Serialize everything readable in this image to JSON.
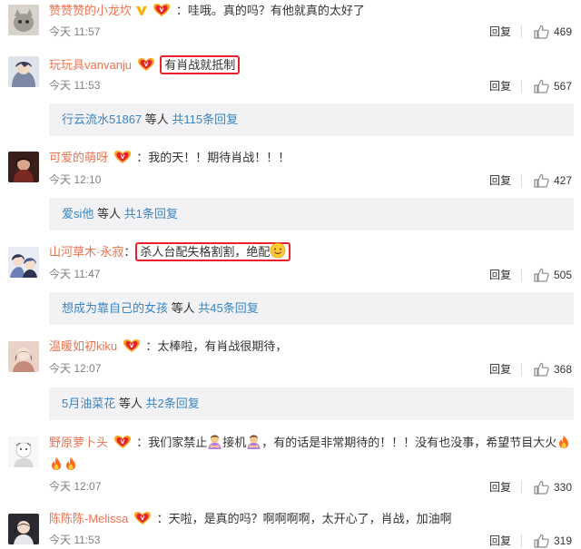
{
  "comments": [
    {
      "username": "赞赞赞的小龙坎",
      "text": "：哇哦。真的吗？有他就真的太好了",
      "time": "今天 11:57",
      "reply": "回复",
      "likes": "469"
    },
    {
      "username": "玩玩具vanvanju",
      "text": "有肖战就抵制",
      "time": "今天 11:53",
      "reply": "回复",
      "likes": "567"
    },
    {
      "username": "可爱的萌呀",
      "text": "：我的天！！期待肖战！！！",
      "time": "今天 12:10",
      "reply": "回复",
      "likes": "427"
    },
    {
      "username": "山河草木·永寂",
      "text": "杀人台配失格割割，绝配",
      "time": "今天 11:47",
      "reply": "回复",
      "likes": "505"
    },
    {
      "username": "温暖如初kiku",
      "text": "：太棒啦，有肖战很期待，",
      "time": "今天 12:07",
      "reply": "回复",
      "likes": "368"
    },
    {
      "username": "野原萝卜头",
      "text_a": "：我们家禁止",
      "text_b": "接机",
      "text_c": "，有的话是非常期待的！！！没有也没事，希望节目大火",
      "time": "今天 12:07",
      "reply": "回复",
      "likes": "330"
    },
    {
      "username": "陈陈陈-Melissa",
      "text": "：天啦，是真的吗？啊啊啊啊，太开心了，肖战，加油啊",
      "time": "今天 11:53",
      "reply": "回复",
      "likes": "319"
    }
  ],
  "reply_bars": [
    {
      "user": "行云流水51867",
      "mid": " 等人 ",
      "count": "共115条回复"
    },
    {
      "user": "爱si他",
      "mid": " 等人 ",
      "count": "共1条回复"
    },
    {
      "user": "想成为靠自己的女孩",
      "mid": " 等人 ",
      "count": "共45条回复"
    },
    {
      "user": "5月油菜花",
      "mid": " 等人 ",
      "count": "共2条回复"
    }
  ],
  "colors": {
    "username": "#eb7350",
    "link": "#3a85c4",
    "highlight": "#e8212a",
    "bar": "#f2f2f5"
  },
  "icons": [
    "vip-badge-icon",
    "gold-v-icon",
    "thumbs-up-icon",
    "smile-emoji-icon",
    "crossed-arms-emoji-icon",
    "fire-emoji-icon"
  ]
}
